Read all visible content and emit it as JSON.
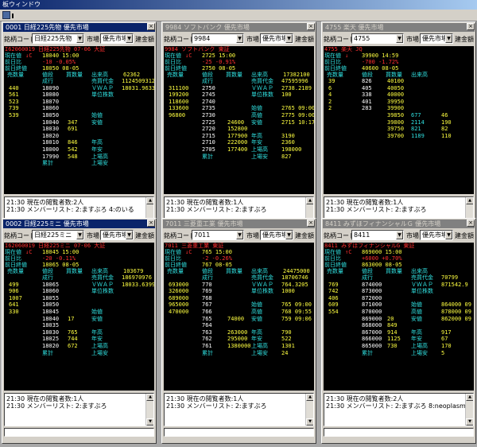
{
  "window_title": "板ウィンドウ",
  "colors": {
    "price": "#ff3030",
    "volume": "#ffff40",
    "label": "#30e0e0",
    "highlight": "#30e030"
  },
  "labels": {
    "code": "銘柄コード",
    "market": "市場",
    "order": "建金額",
    "bid_vol": "売数量",
    "price": "値段",
    "ask_vol": "買数量",
    "out": "出来高",
    "vwap": "ＶＷＡＰ",
    "unit": "単位株数",
    "start": "始値",
    "high": "高値",
    "low": "安値",
    "prev": "前日比",
    "prevclose": "前日終値",
    "now": "現在値"
  },
  "panels": [
    {
      "title": "0001 日経225先物 優先市場",
      "code_value": "日経225先物",
      "market_value": "優先市場",
      "active": true,
      "header": "I62060019 日経225先物 07-06 大証",
      "now": "18040 15:00",
      "now_mark": "↓C",
      "diff": "-10 -0.05%",
      "prev": "18050 08-05",
      "rows": [
        {
          "bid": "",
          "price": "成行",
          "ask": "",
          "k": "売買代金",
          "v": "1124509312"
        },
        {
          "bid": "440",
          "price": "18090",
          "ask": "",
          "k": "ＶＷＡＰ",
          "v": "18031.9633"
        },
        {
          "bid": "561",
          "price": "18080",
          "ask": "",
          "k": "単位株数",
          "v": ""
        },
        {
          "bid": "523",
          "price": "18070",
          "ask": "",
          "k": "",
          "v": ""
        },
        {
          "bid": "739",
          "price": "18060",
          "ask": "",
          "k": "",
          "v": ""
        },
        {
          "bid": "539",
          "price": "18050",
          "ask": "",
          "k": "始値",
          "v": ""
        },
        {
          "bid": "",
          "price": "18040",
          "ask": "347",
          "k": "安値",
          "v": ""
        },
        {
          "bid": "",
          "price": "18030",
          "ask": "691",
          "k": "",
          "v": ""
        },
        {
          "bid": "",
          "price": "18020",
          "ask": "",
          "k": "",
          "v": ""
        },
        {
          "bid": "",
          "price": "18010",
          "ask": "846",
          "k": "年高",
          "v": ""
        },
        {
          "bid": "",
          "price": "18000",
          "ask": "542",
          "k": "年安",
          "v": ""
        },
        {
          "bid": "",
          "price": "17990",
          "ask": "548",
          "k": "上場高",
          "v": ""
        },
        {
          "bid": "",
          "price": "累計",
          "ask": "",
          "k": "上場安",
          "v": ""
        }
      ],
      "out_vol": "62362",
      "log": [
        "21:30 現在の閲覧者数:2人",
        "21:30 メンバーリスト: 2:ますぶろ 4:のいる"
      ]
    },
    {
      "title": "9984 ソフトバンク 優先市場",
      "code_value": "9984",
      "market_value": "優先市場",
      "active": false,
      "header": "9984 ソフトバンク 東証",
      "now": "2725 15:00",
      "now_mark": "↓C",
      "diff": "-25 -0.91%",
      "prev": "2750 08-05",
      "rows": [
        {
          "bid": "",
          "price": "成行",
          "ask": "",
          "k": "売買代金",
          "v": "47595996"
        },
        {
          "bid": "311100",
          "price": "2750",
          "ask": "",
          "k": "ＶＷＡＰ",
          "v": "2738.2189"
        },
        {
          "bid": "199200",
          "price": "2745",
          "ask": "",
          "k": "単位株数",
          "v": "100"
        },
        {
          "bid": "118600",
          "price": "2740",
          "ask": "",
          "k": "",
          "v": ""
        },
        {
          "bid": "133600",
          "price": "2735",
          "ask": "",
          "k": "始値",
          "v": "2765 09:00"
        },
        {
          "bid": "96800",
          "price": "2730",
          "ask": "",
          "k": "高値",
          "v": "2775 09:00"
        },
        {
          "bid": "",
          "price": "2725",
          "ask": "24600",
          "k": "安値",
          "v": "2715 10:17"
        },
        {
          "bid": "",
          "price": "2720",
          "ask": "152800",
          "k": "",
          "v": ""
        },
        {
          "bid": "",
          "price": "2715",
          "ask": "177900",
          "k": "年高",
          "v": "3190"
        },
        {
          "bid": "",
          "price": "2710",
          "ask": "222000",
          "k": "年安",
          "v": "2360"
        },
        {
          "bid": "",
          "price": "2705",
          "ask": "177400",
          "k": "上場高",
          "v": "198000"
        },
        {
          "bid": "",
          "price": "累計",
          "ask": "",
          "k": "上場安",
          "v": "827"
        }
      ],
      "out_vol": "17382100",
      "log": [
        "21:30 現在の閲覧者数:1人",
        "21:30 メンバーリスト: 2:ますぶろ"
      ]
    },
    {
      "title": "4755 楽天 優先市場",
      "code_value": "4755",
      "market_value": "優先市場",
      "active": false,
      "header": "4755 楽天 JQ",
      "now": "39900 14:59",
      "now_mark": "↓",
      "diff": "-700 -1.72%",
      "prev": "40600 08-05",
      "rows": [
        {
          "bid": "39",
          "price": "826",
          "ask": "40100",
          "k": "",
          "v": ""
        },
        {
          "bid": "6",
          "price": "405",
          "ask": "40050",
          "k": "",
          "v": ""
        },
        {
          "bid": "4",
          "price": "338",
          "ask": "40000",
          "k": "",
          "v": ""
        },
        {
          "bid": "2",
          "price": "401",
          "ask": "39950",
          "k": "",
          "v": ""
        },
        {
          "bid": "2",
          "price": "283",
          "ask": "39900",
          "k": "",
          "v": ""
        },
        {
          "bid": "",
          "price": "",
          "ask": "39850",
          "k": "677",
          "v": "46"
        },
        {
          "bid": "",
          "price": "",
          "ask": "39800",
          "k": "2114",
          "v": "190"
        },
        {
          "bid": "",
          "price": "",
          "ask": "39750",
          "k": "821",
          "v": "82"
        },
        {
          "bid": "",
          "price": "",
          "ask": "39700",
          "k": "1189",
          "v": "110"
        }
      ],
      "log": [
        "21:30 現在の閲覧者数:1人",
        "21:30 メンバーリスト: 2:ますぶろ"
      ]
    },
    {
      "title": "0002 日経225ミニ 優先市場",
      "code_value": "日経225ミニ",
      "market_value": "優先市場",
      "active": true,
      "header": "I62060019 日経225ミニ 07-06 大証",
      "now": "18045 15:00",
      "now_mark": "↓C",
      "diff": "-20 -0.11%",
      "prev": "18065 08-05",
      "rows": [
        {
          "bid": "",
          "price": "成行",
          "ask": "",
          "k": "売買代金",
          "v": "186970976"
        },
        {
          "bid": "499",
          "price": "18065",
          "ask": "",
          "k": "ＶＷＡＰ",
          "v": "18033.6399"
        },
        {
          "bid": "906",
          "price": "18060",
          "ask": "",
          "k": "単位株数",
          "v": ""
        },
        {
          "bid": "1007",
          "price": "18055",
          "ask": "",
          "k": "",
          "v": ""
        },
        {
          "bid": "641",
          "price": "18050",
          "ask": "",
          "k": "",
          "v": ""
        },
        {
          "bid": "330",
          "price": "18045",
          "ask": "",
          "k": "始値",
          "v": ""
        },
        {
          "bid": "",
          "price": "18040",
          "ask": "17",
          "k": "安値",
          "v": ""
        },
        {
          "bid": "",
          "price": "18035",
          "ask": "",
          "k": "",
          "v": ""
        },
        {
          "bid": "",
          "price": "18030",
          "ask": "765",
          "k": "年高",
          "v": ""
        },
        {
          "bid": "",
          "price": "18025",
          "ask": "744",
          "k": "年安",
          "v": ""
        },
        {
          "bid": "",
          "price": "18020",
          "ask": "672",
          "k": "上場高",
          "v": ""
        },
        {
          "bid": "",
          "price": "累計",
          "ask": "",
          "k": "上場安",
          "v": ""
        }
      ],
      "out_vol": "103679",
      "log": [
        "21:30 現在の閲覧者数:1人",
        "21:30 メンバーリスト: 2:ますぶろ"
      ]
    },
    {
      "title": "7011 三菱重工業 優先市場",
      "code_value": "7011",
      "market_value": "優先市場",
      "active": false,
      "header": "7011 三菱重工業 東証",
      "now": "765 15:00",
      "now_mark": "↓C",
      "diff": "-2 -0.26%",
      "prev": "767 08-05",
      "rows": [
        {
          "bid": "",
          "price": "成行",
          "ask": "",
          "k": "売買代金",
          "v": "18706746"
        },
        {
          "bid": "693000",
          "price": "770",
          "ask": "",
          "k": "ＶＷＡＰ",
          "v": "764.3205"
        },
        {
          "bid": "326000",
          "price": "769",
          "ask": "",
          "k": "単位株数",
          "v": "1000"
        },
        {
          "bid": "689000",
          "price": "768",
          "ask": "",
          "k": "",
          "v": ""
        },
        {
          "bid": "965000",
          "price": "767",
          "ask": "",
          "k": "始値",
          "v": "765 09:00"
        },
        {
          "bid": "470000",
          "price": "766",
          "ask": "",
          "k": "高値",
          "v": "768 09:55"
        },
        {
          "bid": "",
          "price": "765",
          "ask": "74000",
          "k": "安値",
          "v": "759 09:06"
        },
        {
          "bid": "",
          "price": "764",
          "ask": "",
          "k": "",
          "v": ""
        },
        {
          "bid": "",
          "price": "763",
          "ask": "263000",
          "k": "年高",
          "v": "790"
        },
        {
          "bid": "",
          "price": "762",
          "ask": "295000",
          "k": "年安",
          "v": "522"
        },
        {
          "bid": "",
          "price": "761",
          "ask": "1380000",
          "k": "上場高",
          "v": "1301"
        },
        {
          "bid": "",
          "price": "累計",
          "ask": "",
          "k": "上場安",
          "v": "24"
        }
      ],
      "out_vol": "24475000",
      "log": [
        "21:30 現在の閲覧者数:1人",
        "21:30 メンバーリスト: 2:ますぶろ"
      ]
    },
    {
      "title": "8411 みずほフィナンシャルＧ 優先市場",
      "code_value": "8411",
      "market_value": "優先市場",
      "active": false,
      "header": "8411 みずほフィナンシャルG 東証",
      "now": "869000 15:00",
      "now_mark": "↑C",
      "diff": "+6000 +0.70%",
      "prev": "863000 08-05",
      "rows": [
        {
          "bid": "",
          "price": "成行",
          "ask": "",
          "k": "売買代金",
          "v": "70799"
        },
        {
          "bid": "769",
          "price": "874000",
          "ask": "",
          "k": "ＶＷＡＰ",
          "v": "871542.9"
        },
        {
          "bid": "742",
          "price": "873000",
          "ask": "",
          "k": "単位株数",
          "v": ""
        },
        {
          "bid": "406",
          "price": "872000",
          "ask": "",
          "k": "",
          "v": ""
        },
        {
          "bid": "609",
          "price": "871000",
          "ask": "",
          "k": "始値",
          "v": "864000 09"
        },
        {
          "bid": "554",
          "price": "870000",
          "ask": "",
          "k": "高値",
          "v": "878000 09"
        },
        {
          "bid": "",
          "price": "869000",
          "ask": "20",
          "k": "安値",
          "v": "862000 09"
        },
        {
          "bid": "",
          "price": "868000",
          "ask": "849",
          "k": "",
          "v": ""
        },
        {
          "bid": "",
          "price": "867000",
          "ask": "914",
          "k": "年高",
          "v": "917"
        },
        {
          "bid": "",
          "price": "866000",
          "ask": "1125",
          "k": "年安",
          "v": "67"
        },
        {
          "bid": "",
          "price": "865000",
          "ask": "730",
          "k": "上場高",
          "v": "170"
        },
        {
          "bid": "",
          "price": "累計",
          "ask": "",
          "k": "上場安",
          "v": "5"
        }
      ],
      "out_vol": "",
      "log": [
        "21:30 現在の閲覧者数:2人",
        "21:30 メンバーリスト: 2:ますぶろ 8:neoplasm"
      ]
    }
  ]
}
